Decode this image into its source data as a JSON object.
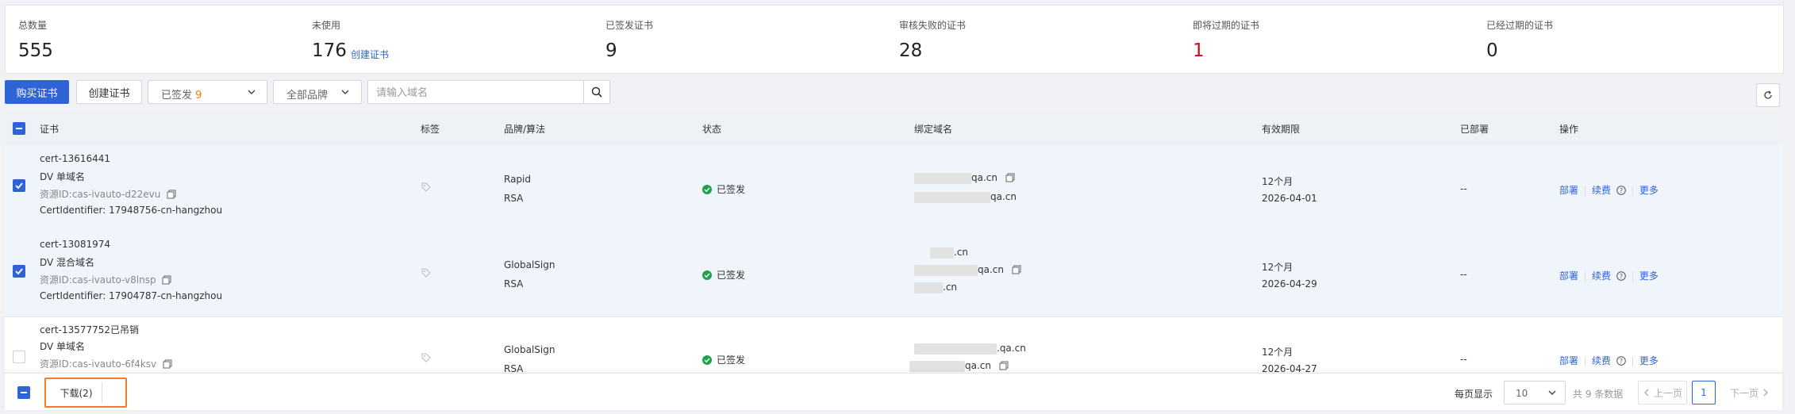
{
  "stats": [
    {
      "label": "总数量",
      "value": "555"
    },
    {
      "label": "未使用",
      "value": "176",
      "link": "创建证书"
    },
    {
      "label": "已签发证书",
      "value": "9"
    },
    {
      "label": "审核失败的证书",
      "value": "28"
    },
    {
      "label": "即将过期的证书",
      "value": "1"
    },
    {
      "label": "已经过期的证书",
      "value": "0"
    }
  ],
  "toolbar": {
    "buy_label": "购买证书",
    "create_label": "创建证书",
    "status_filter": "已签发",
    "status_count": "9",
    "brand_filter": "全部品牌",
    "search_placeholder": "请输入域名"
  },
  "columns": [
    "证书",
    "标签",
    "品牌/算法",
    "状态",
    "绑定域名",
    "有效期限",
    "已部署",
    "操作"
  ],
  "rows": [
    {
      "name": "cert-13616441",
      "type": "DV 单域名",
      "resource": "资源ID:cas-ivauto-d22evu",
      "identifier": "CertIdentifier: 17948756-cn-hangzhou",
      "brand": "Rapid",
      "algo": "RSA",
      "status": "已签发",
      "domains": [
        "qa.cn",
        "qa.cn"
      ],
      "period": "12个月",
      "expire": "2026-04-01",
      "deployed": "--",
      "actions": {
        "deploy": "部署",
        "renew": "续费",
        "more": "更多"
      }
    },
    {
      "name": "cert-13081974",
      "type": "DV 混合域名",
      "resource": "资源ID:cas-ivauto-v8lnsp",
      "identifier": "CertIdentifier: 17904787-cn-hangzhou",
      "brand": "GlobalSign",
      "algo": "RSA",
      "status": "已签发",
      "domains": [
        ".cn",
        "qa.cn",
        ".cn"
      ],
      "period": "12个月",
      "expire": "2026-04-29",
      "deployed": "--",
      "actions": {
        "deploy": "部署",
        "renew": "续费",
        "more": "更多"
      }
    },
    {
      "name": "cert-13577752已吊销",
      "type": "DV 单域名",
      "resource": "资源ID:cas-ivauto-6f4ksv",
      "brand": "GlobalSign",
      "algo": "RSA",
      "status": "已签发",
      "domains": ".qa.cn",
      "domains2": "qa.cn",
      "period": "12个月",
      "expire": "2026-04-27",
      "deployed": "--",
      "actions": {
        "deploy": "部署",
        "renew": "续费",
        "more": "更多"
      }
    }
  ],
  "footer": {
    "download_label": "下载(2)",
    "per_page_label": "每页显示",
    "page_size": "10",
    "total": "共 9 条数据",
    "prev": "上一页",
    "current_page": "1",
    "next": "下一页"
  },
  "colors": {
    "primary": "#2e64d6",
    "success": "#1fa34a",
    "danger": "#d9001b",
    "highlight": "#f07c28"
  }
}
